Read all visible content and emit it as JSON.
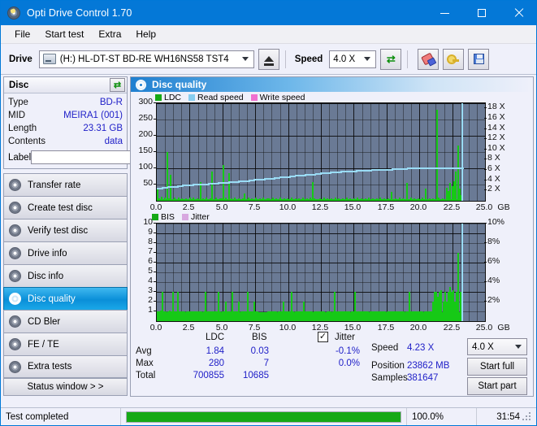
{
  "window": {
    "title": "Opti Drive Control 1.70",
    "icon": "disc-icon",
    "minimize": "–",
    "maximize": "□",
    "close": "✕"
  },
  "menu": {
    "items": [
      {
        "label": "File",
        "name": "menu-file"
      },
      {
        "label": "Start test",
        "name": "menu-start-test"
      },
      {
        "label": "Extra",
        "name": "menu-extra"
      },
      {
        "label": "Help",
        "name": "menu-help"
      }
    ]
  },
  "toolbar": {
    "drive_label": "Drive",
    "drive_value": "(H:)   HL-DT-ST BD-RE  WH16NS58 TST4",
    "eject_title": "Eject",
    "speed_label": "Speed",
    "speed_value": "4.0 X",
    "refresh_glyph": "⇄",
    "erase_title": "Erase",
    "key_title": "Key",
    "save_title": "Save"
  },
  "disc_panel": {
    "header": "Disc",
    "refresh_glyph": "⇄",
    "rows": [
      {
        "key": "Type",
        "value": "BD-R"
      },
      {
        "key": "MID",
        "value": "MEIRA1 (001)"
      },
      {
        "key": "Length",
        "value": "23.31 GB"
      },
      {
        "key": "Contents",
        "value": "data"
      }
    ],
    "label_key": "Label",
    "label_value": "",
    "label_placeholder": ""
  },
  "nav": {
    "items": [
      {
        "label": "Transfer rate",
        "name": "sidebar-item-transfer-rate",
        "active": false
      },
      {
        "label": "Create test disc",
        "name": "sidebar-item-create-test-disc",
        "active": false
      },
      {
        "label": "Verify test disc",
        "name": "sidebar-item-verify-test-disc",
        "active": false
      },
      {
        "label": "Drive info",
        "name": "sidebar-item-drive-info",
        "active": false
      },
      {
        "label": "Disc info",
        "name": "sidebar-item-disc-info",
        "active": false
      },
      {
        "label": "Disc quality",
        "name": "sidebar-item-disc-quality",
        "active": true
      },
      {
        "label": "CD Bler",
        "name": "sidebar-item-cd-bler",
        "active": false
      },
      {
        "label": "FE / TE",
        "name": "sidebar-item-fe-te",
        "active": false
      },
      {
        "label": "Extra tests",
        "name": "sidebar-item-extra-tests",
        "active": false
      }
    ],
    "status_window": "Status window > >"
  },
  "content": {
    "header": "Disc quality"
  },
  "stats": {
    "col_ldc": "LDC",
    "col_bis": "BIS",
    "col_jitter": "Jitter",
    "jitter_checked": true,
    "check_glyph": "✓",
    "row_avg": "Avg",
    "row_max": "Max",
    "row_total": "Total",
    "avg_ldc": "1.84",
    "avg_bis": "0.03",
    "avg_jitter": "-0.1%",
    "max_ldc": "280",
    "max_bis": "7",
    "max_jitter": "0.0%",
    "total_ldc": "700855",
    "total_bis": "10685",
    "speed_label": "Speed",
    "speed_value": "4.23 X",
    "position_label": "Position",
    "position_value": "23862 MB",
    "samples_label": "Samples",
    "samples_value": "381647",
    "speed_select": "4.0 X",
    "start_full": "Start full",
    "start_part": "Start part"
  },
  "statusbar": {
    "message": "Test completed",
    "percent": "100.0%",
    "progress": 100,
    "time": "31:54"
  },
  "chart_data": [
    {
      "type": "bar",
      "name": "ldc-chart",
      "title": "",
      "xlabel": "GB",
      "ylabel": "",
      "legend": [
        {
          "label": "LDC",
          "color": "#16a916"
        },
        {
          "label": "Read speed",
          "color": "#87cdf0"
        },
        {
          "label": "Write speed",
          "color": "#f070d0"
        }
      ],
      "yticks": [
        50,
        100,
        150,
        200,
        250,
        300
      ],
      "ylim": [
        0,
        300
      ],
      "y2ticks": [
        "2 X",
        "4 X",
        "6 X",
        "8 X",
        "10 X",
        "12 X",
        "14 X",
        "16 X",
        "18 X"
      ],
      "y2lim": [
        0,
        19
      ],
      "xticks": [
        "0.0",
        "2.5",
        "5.0",
        "7.5",
        "10.0",
        "12.5",
        "15.0",
        "17.5",
        "20.0",
        "22.5",
        "25.0"
      ],
      "xunit": "GB",
      "xlim": [
        0,
        25
      ],
      "grid": true,
      "x": [
        0.05,
        0.18,
        0.3,
        0.45,
        0.6,
        0.75,
        0.9,
        1.05,
        1.2,
        1.35,
        1.5,
        1.65,
        1.8,
        1.95,
        2.1,
        2.25,
        2.4,
        2.55,
        2.7,
        2.85,
        3.0,
        3.15,
        3.3,
        3.45,
        3.6,
        3.75,
        3.9,
        4.05,
        4.2,
        4.35,
        4.5,
        4.65,
        4.8,
        4.95,
        5.1,
        5.25,
        5.4,
        5.55,
        5.7,
        5.85,
        6.0,
        6.15,
        6.3,
        6.45,
        6.6,
        6.75,
        6.9,
        7.05,
        7.2,
        7.35,
        7.5,
        7.65,
        7.8,
        7.95,
        8.1,
        8.25,
        8.4,
        8.55,
        8.7,
        8.85,
        9.0,
        9.15,
        9.3,
        9.45,
        9.6,
        9.75,
        9.9,
        10.05,
        10.2,
        10.35,
        10.5,
        10.65,
        10.8,
        10.95,
        11.1,
        11.25,
        11.4,
        11.55,
        11.7,
        11.85,
        12.0,
        12.15,
        12.3,
        12.45,
        12.6,
        12.75,
        12.9,
        13.05,
        13.2,
        13.35,
        13.5,
        13.65,
        13.8,
        13.95,
        14.1,
        14.25,
        14.4,
        14.55,
        14.7,
        14.85,
        15.0,
        15.15,
        15.3,
        15.45,
        15.6,
        15.75,
        15.9,
        16.05,
        16.2,
        16.35,
        16.5,
        16.65,
        16.8,
        16.95,
        17.1,
        17.25,
        17.4,
        17.55,
        17.7,
        17.85,
        18.0,
        18.15,
        18.3,
        18.45,
        18.6,
        18.75,
        18.9,
        19.05,
        19.2,
        19.35,
        19.5,
        19.65,
        19.8,
        19.95,
        20.1,
        20.25,
        20.4,
        20.55,
        20.7,
        20.85,
        21.0,
        21.15,
        21.3,
        21.45,
        21.6,
        21.75,
        21.9,
        22.05,
        22.2,
        22.35,
        22.5,
        22.65,
        22.8,
        22.95,
        23.1,
        23.25
      ],
      "values": [
        40,
        8,
        12,
        6,
        10,
        150,
        7,
        80,
        6,
        9,
        5,
        11,
        6,
        8,
        4,
        7,
        6,
        10,
        5,
        9,
        6,
        7,
        5,
        58,
        8,
        6,
        11,
        5,
        7,
        90,
        6,
        10,
        5,
        8,
        7,
        110,
        9,
        6,
        85,
        7,
        5,
        9,
        6,
        8,
        5,
        7,
        22,
        6,
        9,
        5,
        8,
        6,
        11,
        5,
        7,
        6,
        9,
        5,
        8,
        7,
        6,
        10,
        5,
        8,
        6,
        9,
        5,
        7,
        6,
        8,
        5,
        9,
        6,
        7,
        5,
        8,
        6,
        10,
        5,
        7,
        6,
        9,
        58,
        7,
        6,
        5,
        8,
        6,
        9,
        5,
        7,
        6,
        8,
        5,
        9,
        6,
        7,
        5,
        8,
        6,
        9,
        5,
        7,
        6,
        8,
        5,
        9,
        6,
        7,
        5,
        8,
        6,
        9,
        5,
        7,
        6,
        8,
        5,
        9,
        6,
        7,
        5,
        8,
        6,
        28,
        5,
        7,
        6,
        9,
        5,
        8,
        6,
        55,
        5,
        9,
        6,
        7,
        5,
        8,
        6,
        9,
        5,
        38,
        6,
        8,
        5,
        7,
        6,
        280,
        9,
        5,
        8,
        6,
        40,
        30,
        55,
        45,
        60,
        90,
        170,
        38,
        18
      ],
      "read_speed_line": [
        2.6,
        2.7,
        2.8,
        2.9,
        3.0,
        3.1,
        3.2,
        3.3,
        3.35,
        3.4,
        3.5,
        3.55,
        3.6,
        3.7,
        3.8,
        3.85,
        3.9,
        4.0,
        4.1,
        4.2,
        4.3,
        4.4,
        4.5,
        4.6,
        4.7,
        4.8,
        4.9,
        5.0,
        5.1,
        5.2,
        5.3,
        5.4,
        5.5,
        5.6,
        5.7,
        5.75,
        5.8,
        5.85,
        5.9,
        5.95,
        6.0,
        6.05,
        6.1,
        6.15,
        6.2,
        6.25,
        6.3,
        6.35,
        6.4,
        6.45,
        6.5,
        6.5,
        6.5,
        6.5,
        6.5,
        6.5,
        6.5,
        6.5,
        6.5,
        6.5
      ]
    },
    {
      "type": "bar",
      "name": "bis-chart",
      "title": "",
      "xlabel": "GB",
      "legend": [
        {
          "label": "BIS",
          "color": "#16a916"
        },
        {
          "label": "Jitter",
          "color": "#d8a8e0"
        }
      ],
      "yticks": [
        1,
        2,
        3,
        4,
        5,
        6,
        7,
        8,
        9,
        10
      ],
      "ylim": [
        0,
        10
      ],
      "y2ticks": [
        "2%",
        "4%",
        "6%",
        "8%",
        "10%"
      ],
      "y2lim": [
        0,
        10
      ],
      "xticks": [
        "0.0",
        "2.5",
        "5.0",
        "7.5",
        "10.0",
        "12.5",
        "15.0",
        "17.5",
        "20.0",
        "22.5",
        "25.0"
      ],
      "xunit": "GB",
      "xlim": [
        0,
        25
      ],
      "grid": true,
      "values": [
        1.0,
        1.0,
        1.1,
        3.0,
        1.0,
        1.0,
        1.0,
        1.1,
        1.0,
        3.0,
        1.0,
        1.0,
        3.0,
        1.0,
        1.0,
        1.0,
        1.0,
        1.0,
        1.0,
        1.0,
        1.0,
        1.0,
        1.0,
        1.0,
        1.0,
        1.0,
        1.0,
        1.0,
        3.0,
        1.0,
        1.0,
        1.0,
        1.0,
        1.0,
        1.0,
        1.0,
        3.0,
        1.0,
        1.0,
        1.0,
        2.0,
        1.0,
        1.0,
        1.0,
        3.0,
        1.0,
        1.0,
        1.0,
        2.0,
        1.0,
        1.0,
        1.0,
        1.0,
        3.0,
        1.0,
        1.0,
        1.0,
        2.0,
        1.0,
        1.0,
        0.2,
        0.2,
        0.2,
        0.2,
        0.2,
        1.0,
        1.0,
        1.0,
        1.0,
        1.0,
        1.0,
        1.0,
        1.0,
        1.0,
        2.0,
        1.0,
        1.0,
        1.0,
        1.0,
        3.0,
        1.0,
        1.0,
        1.0,
        1.0,
        1.0,
        1.0,
        2.0,
        1.0,
        1.0,
        1.0,
        1.0,
        1.0,
        1.0,
        1.0,
        1.0,
        1.0,
        1.0,
        1.0,
        1.0,
        0.2,
        1.0,
        1.0,
        1.0,
        1.0,
        3.0,
        1.0,
        1.0,
        1.0,
        1.0,
        1.0,
        1.0,
        1.0,
        1.0,
        1.0,
        1.0,
        1.0,
        3.0,
        1.0,
        1.0,
        1.0,
        1.0,
        1.0,
        1.0,
        1.0,
        1.0,
        1.0,
        1.0,
        1.0,
        1.0,
        1.0,
        1.0,
        1.0,
        1.0,
        1.0,
        1.0,
        1.0,
        1.0,
        1.0,
        1.0,
        1.0,
        1.0,
        1.0,
        1.0,
        1.0,
        1.0,
        1.0,
        1.0,
        1.0,
        3.0,
        1.0,
        1.0,
        1.0,
        1.0,
        1.0,
        1.0,
        1.0,
        1.0,
        1.0,
        1.0,
        1.0,
        1.0,
        1.0,
        2.0,
        3.0,
        3.0,
        2.5,
        3.0,
        3.2,
        2.0,
        3.0,
        2.0,
        3.0,
        3.5,
        3.0,
        3.2,
        2.0,
        3.0,
        7.0,
        3.0,
        1.0
      ]
    }
  ]
}
